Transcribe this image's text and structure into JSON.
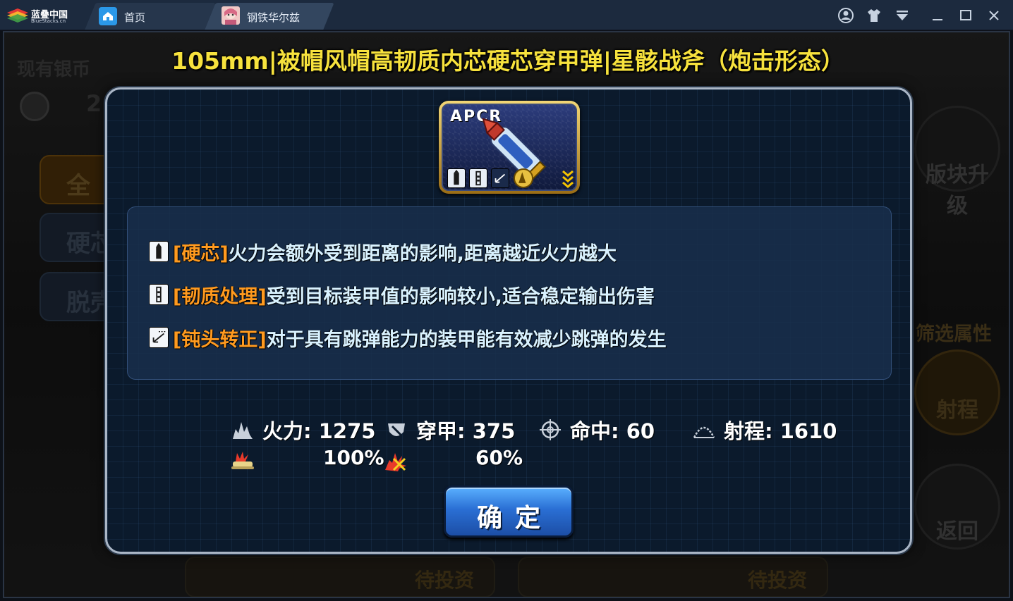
{
  "bluestacks": {
    "brand": "蓝叠中国",
    "brand_sub": "BlueStacks.cn",
    "tabs": [
      {
        "label": "首页",
        "icon": "home-icon"
      },
      {
        "label": "钢铁华尔兹",
        "icon": "game-icon"
      }
    ],
    "controls": [
      "account-icon",
      "shirt-icon",
      "dropdown-icon",
      "minimize-icon",
      "maximize-icon",
      "close-icon"
    ]
  },
  "background": {
    "silver_label": "现有银币",
    "silver_value": "2",
    "side_buttons": [
      "全",
      "硬芯",
      "脱壳"
    ],
    "right_buttons": {
      "upgrade": "版块升级",
      "filter_title": "筛选属性",
      "range": "射程",
      "back": "返回"
    },
    "card_status": [
      "待投资",
      "待投资"
    ]
  },
  "dialog": {
    "title": "105mm|被帽风帽高韧质内芯硬芯穿甲弹|星骸战斧（炮击形态）",
    "shell_code": "APCR",
    "traits": [
      {
        "name": "[硬芯]",
        "desc": "火力会额外受到距离的影响,距离越近火力越大",
        "icon": "hard-core-icon"
      },
      {
        "name": "[韧质处理]",
        "desc": "受到目标装甲值的影响较小,适合稳定输出伤害",
        "icon": "toughness-icon"
      },
      {
        "name": "[钝头转正]",
        "desc": "对于具有跳弹能力的装甲能有效减少跳弹的发生",
        "icon": "blunt-head-icon"
      }
    ],
    "stats": [
      {
        "label": "火力",
        "value": "1275",
        "icon": "firepower-icon"
      },
      {
        "label": "穿甲",
        "value": "375",
        "icon": "penetration-icon"
      },
      {
        "label": "命中",
        "value": "60",
        "icon": "accuracy-icon"
      },
      {
        "label": "射程",
        "value": "1610",
        "icon": "range-icon"
      }
    ],
    "modifiers": [
      {
        "value": "100%",
        "icon": "tank-hit-icon"
      },
      {
        "value": "60%",
        "icon": "explosion-icon"
      }
    ],
    "confirm_label": "确定"
  },
  "colors": {
    "title": "#f7e23d",
    "trait_name": "#ff9a1f",
    "trait_desc": "#d9f2ff",
    "confirm": "#2a6fd4",
    "modal_border": "#aab6c6"
  }
}
